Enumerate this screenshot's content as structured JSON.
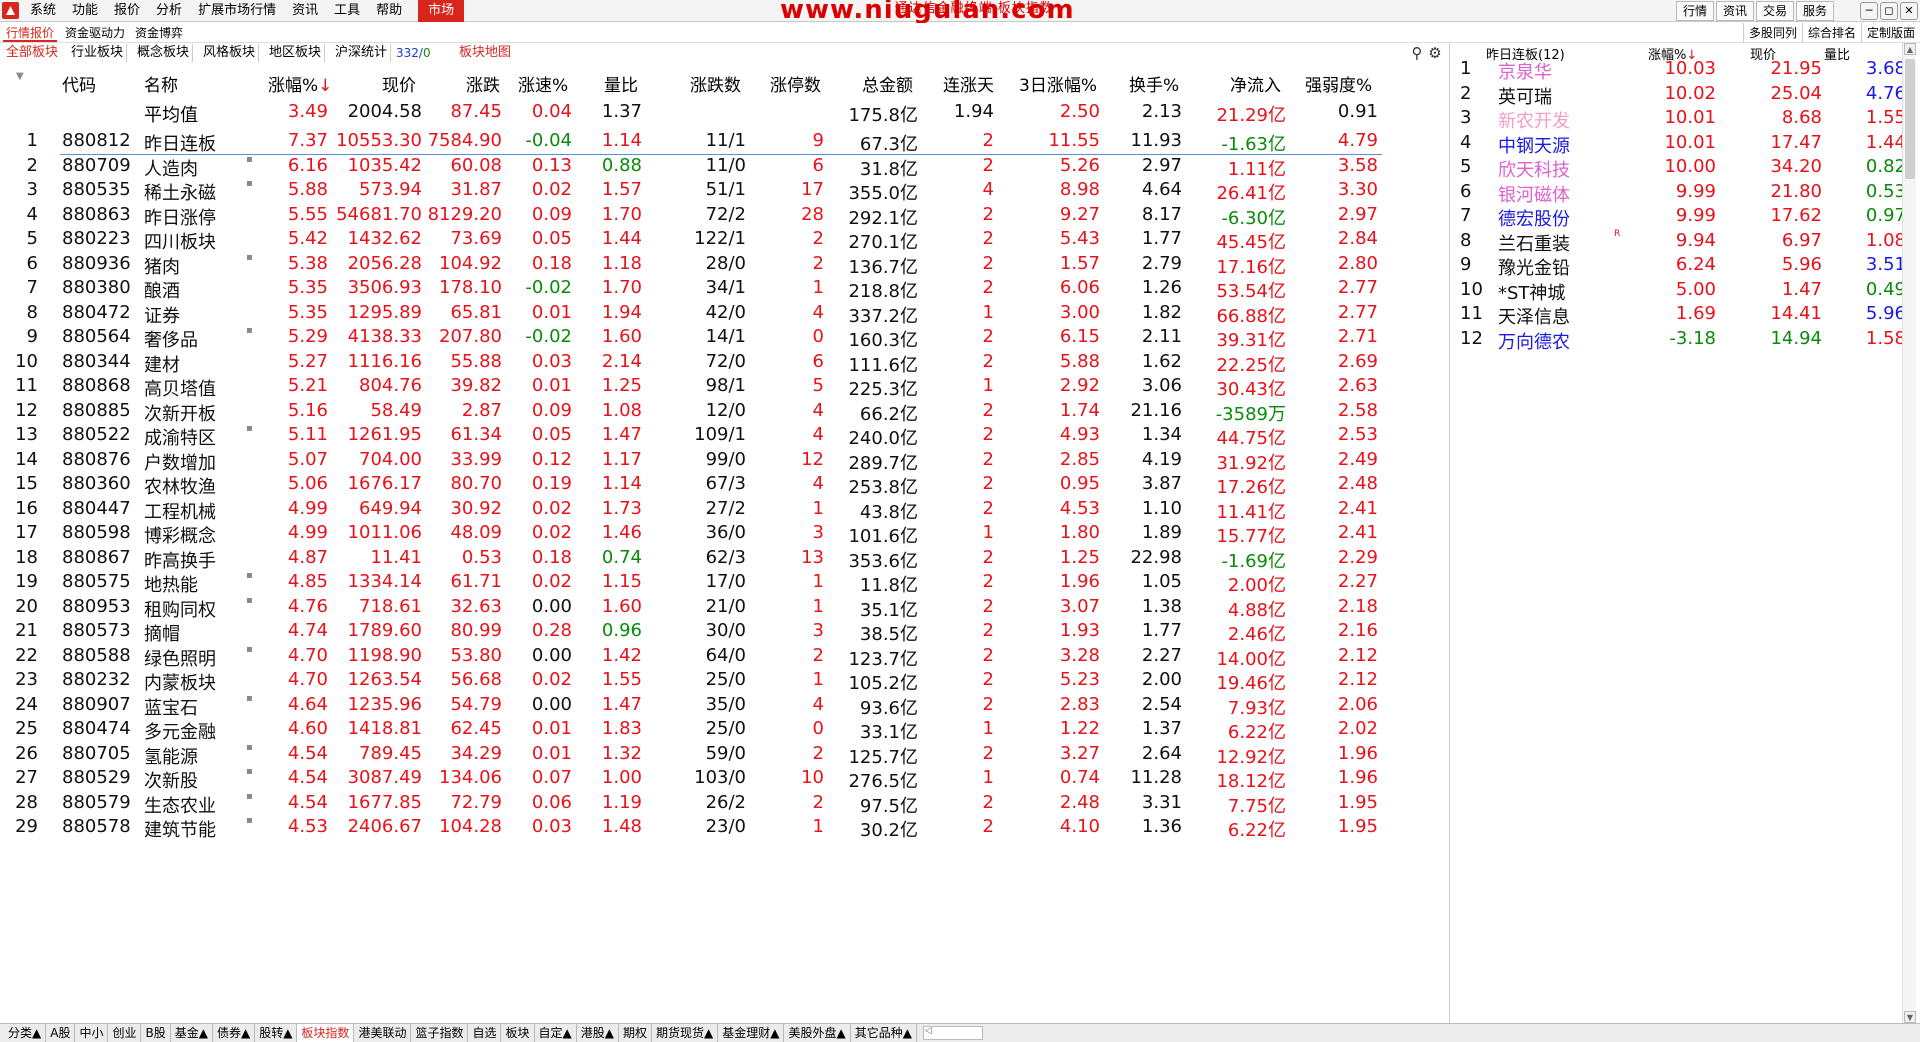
{
  "menu": [
    "系统",
    "功能",
    "报价",
    "分析",
    "扩展市场行情",
    "资讯",
    "工具",
    "帮助",
    "市场"
  ],
  "title": "www.niugulan.com",
  "subtitle": "通达信金融终端 板块指数",
  "right_buttons": [
    "行情",
    "资讯",
    "交易",
    "服务"
  ],
  "window_controls": [
    "─",
    "◻",
    "✕"
  ],
  "tabs1": [
    "行情报价",
    "资金驱动力",
    "资金博弈"
  ],
  "tabs1_right": [
    "多股同列",
    "综合排名",
    "定制版面"
  ],
  "tabs2": [
    "全部板块",
    "行业板块",
    "概念板块",
    "风格板块",
    "地区板块",
    "沪深统计"
  ],
  "counter": {
    "a": "332",
    "sep": "/",
    "b": "0"
  },
  "map_tab": "板块地图",
  "tool_icons": {
    "search": "⚲",
    "gear": "⚙"
  },
  "columns": {
    "code": "代码",
    "name": "名称",
    "chg": "涨幅%",
    "chg_arrow": "↓",
    "price": "现价",
    "diff": "涨跌",
    "speed": "涨速%",
    "vol": "量比",
    "ud": "涨跌数",
    "lim": "涨停数",
    "amt": "总金额",
    "streak": "连涨天",
    "d3": "3日涨幅%",
    "turn": "换手%",
    "flow": "净流入",
    "str": "强弱度%"
  },
  "avg_row": {
    "name": "平均值",
    "chg": "3.49",
    "price": "2004.58",
    "diff": "87.45",
    "speed": "0.04",
    "vol": "1.37",
    "amt": "175.8亿",
    "streak": "1.94",
    "d3": "2.50",
    "turn": "2.13",
    "flow": "21.29亿",
    "str": "0.91"
  },
  "rows": [
    {
      "idx": "1",
      "code": "880812",
      "name": "昨日连板",
      "dot": "",
      "chg": "7.37",
      "price": "10553.30",
      "diff": "7584.90",
      "speed": "-0.04",
      "vol": "1.14",
      "ud": "11/1",
      "lim": "9",
      "amt": "67.3亿",
      "streak": "2",
      "d3": "11.55",
      "turn": "11.93",
      "flow": "-1.63亿",
      "str": "4.79"
    },
    {
      "idx": "2",
      "code": "880709",
      "name": "人造肉",
      "dot": "▪",
      "chg": "6.16",
      "price": "1035.42",
      "diff": "60.08",
      "speed": "0.13",
      "vol": "0.88",
      "ud": "11/0",
      "lim": "6",
      "amt": "31.8亿",
      "streak": "2",
      "d3": "5.26",
      "turn": "2.97",
      "flow": "1.11亿",
      "str": "3.58"
    },
    {
      "idx": "3",
      "code": "880535",
      "name": "稀土永磁",
      "dot": "▪",
      "chg": "5.88",
      "price": "573.94",
      "diff": "31.87",
      "speed": "0.02",
      "vol": "1.57",
      "ud": "51/1",
      "lim": "17",
      "amt": "355.0亿",
      "streak": "4",
      "d3": "8.98",
      "turn": "4.64",
      "flow": "26.41亿",
      "str": "3.30"
    },
    {
      "idx": "4",
      "code": "880863",
      "name": "昨日涨停",
      "dot": "",
      "chg": "5.55",
      "price": "54681.70",
      "diff": "8129.20",
      "speed": "0.09",
      "vol": "1.70",
      "ud": "72/2",
      "lim": "28",
      "amt": "292.1亿",
      "streak": "2",
      "d3": "9.27",
      "turn": "8.17",
      "flow": "-6.30亿",
      "str": "2.97"
    },
    {
      "idx": "5",
      "code": "880223",
      "name": "四川板块",
      "dot": "",
      "chg": "5.42",
      "price": "1432.62",
      "diff": "73.69",
      "speed": "0.05",
      "vol": "1.44",
      "ud": "122/1",
      "lim": "2",
      "amt": "270.1亿",
      "streak": "2",
      "d3": "5.43",
      "turn": "1.77",
      "flow": "45.45亿",
      "str": "2.84"
    },
    {
      "idx": "6",
      "code": "880936",
      "name": "猪肉",
      "dot": "▪",
      "chg": "5.38",
      "price": "2056.28",
      "diff": "104.92",
      "speed": "0.18",
      "vol": "1.18",
      "ud": "28/0",
      "lim": "2",
      "amt": "136.7亿",
      "streak": "2",
      "d3": "1.57",
      "turn": "2.79",
      "flow": "17.16亿",
      "str": "2.80"
    },
    {
      "idx": "7",
      "code": "880380",
      "name": "酿酒",
      "dot": "",
      "chg": "5.35",
      "price": "3506.93",
      "diff": "178.10",
      "speed": "-0.02",
      "vol": "1.70",
      "ud": "34/1",
      "lim": "1",
      "amt": "218.8亿",
      "streak": "2",
      "d3": "6.06",
      "turn": "1.26",
      "flow": "53.54亿",
      "str": "2.77"
    },
    {
      "idx": "8",
      "code": "880472",
      "name": "证券",
      "dot": "",
      "chg": "5.35",
      "price": "1295.89",
      "diff": "65.81",
      "speed": "0.01",
      "vol": "1.94",
      "ud": "42/0",
      "lim": "4",
      "amt": "337.2亿",
      "streak": "1",
      "d3": "3.00",
      "turn": "1.82",
      "flow": "66.88亿",
      "str": "2.77"
    },
    {
      "idx": "9",
      "code": "880564",
      "name": "奢侈品",
      "dot": "▪",
      "chg": "5.29",
      "price": "4138.33",
      "diff": "207.80",
      "speed": "-0.02",
      "vol": "1.60",
      "ud": "14/1",
      "lim": "0",
      "amt": "160.3亿",
      "streak": "2",
      "d3": "6.15",
      "turn": "2.11",
      "flow": "39.31亿",
      "str": "2.71"
    },
    {
      "idx": "10",
      "code": "880344",
      "name": "建材",
      "dot": "",
      "chg": "5.27",
      "price": "1116.16",
      "diff": "55.88",
      "speed": "0.03",
      "vol": "2.14",
      "ud": "72/0",
      "lim": "6",
      "amt": "111.6亿",
      "streak": "2",
      "d3": "5.88",
      "turn": "1.62",
      "flow": "22.25亿",
      "str": "2.69"
    },
    {
      "idx": "11",
      "code": "880868",
      "name": "高贝塔值",
      "dot": "",
      "chg": "5.21",
      "price": "804.76",
      "diff": "39.82",
      "speed": "0.01",
      "vol": "1.25",
      "ud": "98/1",
      "lim": "5",
      "amt": "225.3亿",
      "streak": "1",
      "d3": "2.92",
      "turn": "3.06",
      "flow": "30.43亿",
      "str": "2.63"
    },
    {
      "idx": "12",
      "code": "880885",
      "name": "次新开板",
      "dot": "",
      "chg": "5.16",
      "price": "58.49",
      "diff": "2.87",
      "speed": "0.09",
      "vol": "1.08",
      "ud": "12/0",
      "lim": "4",
      "amt": "66.2亿",
      "streak": "2",
      "d3": "1.74",
      "turn": "21.16",
      "flow": "-3589万",
      "str": "2.58"
    },
    {
      "idx": "13",
      "code": "880522",
      "name": "成渝特区",
      "dot": "▪",
      "chg": "5.11",
      "price": "1261.95",
      "diff": "61.34",
      "speed": "0.05",
      "vol": "1.47",
      "ud": "109/1",
      "lim": "4",
      "amt": "240.0亿",
      "streak": "2",
      "d3": "4.93",
      "turn": "1.34",
      "flow": "44.75亿",
      "str": "2.53"
    },
    {
      "idx": "14",
      "code": "880876",
      "name": "户数增加",
      "dot": "",
      "chg": "5.07",
      "price": "704.00",
      "diff": "33.99",
      "speed": "0.12",
      "vol": "1.17",
      "ud": "99/0",
      "lim": "12",
      "amt": "289.7亿",
      "streak": "2",
      "d3": "2.85",
      "turn": "4.19",
      "flow": "31.92亿",
      "str": "2.49"
    },
    {
      "idx": "15",
      "code": "880360",
      "name": "农林牧渔",
      "dot": "",
      "chg": "5.06",
      "price": "1676.17",
      "diff": "80.70",
      "speed": "0.19",
      "vol": "1.14",
      "ud": "67/3",
      "lim": "4",
      "amt": "253.8亿",
      "streak": "2",
      "d3": "0.95",
      "turn": "3.87",
      "flow": "17.26亿",
      "str": "2.48"
    },
    {
      "idx": "16",
      "code": "880447",
      "name": "工程机械",
      "dot": "",
      "chg": "4.99",
      "price": "649.94",
      "diff": "30.92",
      "speed": "0.02",
      "vol": "1.73",
      "ud": "27/2",
      "lim": "1",
      "amt": "43.8亿",
      "streak": "2",
      "d3": "4.53",
      "turn": "1.10",
      "flow": "11.41亿",
      "str": "2.41"
    },
    {
      "idx": "17",
      "code": "880598",
      "name": "博彩概念",
      "dot": "",
      "chg": "4.99",
      "price": "1011.06",
      "diff": "48.09",
      "speed": "0.02",
      "vol": "1.46",
      "ud": "36/0",
      "lim": "3",
      "amt": "101.6亿",
      "streak": "1",
      "d3": "1.80",
      "turn": "1.89",
      "flow": "15.77亿",
      "str": "2.41"
    },
    {
      "idx": "18",
      "code": "880867",
      "name": "昨高换手",
      "dot": "",
      "chg": "4.87",
      "price": "11.41",
      "diff": "0.53",
      "speed": "0.18",
      "vol": "0.74",
      "ud": "62/3",
      "lim": "13",
      "amt": "353.6亿",
      "streak": "2",
      "d3": "1.25",
      "turn": "22.98",
      "flow": "-1.69亿",
      "str": "2.29"
    },
    {
      "idx": "19",
      "code": "880575",
      "name": "地热能",
      "dot": "▪",
      "chg": "4.85",
      "price": "1334.14",
      "diff": "61.71",
      "speed": "0.02",
      "vol": "1.15",
      "ud": "17/0",
      "lim": "1",
      "amt": "11.8亿",
      "streak": "2",
      "d3": "1.96",
      "turn": "1.05",
      "flow": "2.00亿",
      "str": "2.27"
    },
    {
      "idx": "20",
      "code": "880953",
      "name": "租购同权",
      "dot": "▪",
      "chg": "4.76",
      "price": "718.61",
      "diff": "32.63",
      "speed": "0.00",
      "vol": "1.60",
      "ud": "21/0",
      "lim": "1",
      "amt": "35.1亿",
      "streak": "2",
      "d3": "3.07",
      "turn": "1.38",
      "flow": "4.88亿",
      "str": "2.18"
    },
    {
      "idx": "21",
      "code": "880573",
      "name": "摘帽",
      "dot": "",
      "chg": "4.74",
      "price": "1789.60",
      "diff": "80.99",
      "speed": "0.28",
      "vol": "0.96",
      "ud": "30/0",
      "lim": "3",
      "amt": "38.5亿",
      "streak": "2",
      "d3": "1.93",
      "turn": "1.77",
      "flow": "2.46亿",
      "str": "2.16"
    },
    {
      "idx": "22",
      "code": "880588",
      "name": "绿色照明",
      "dot": "▪",
      "chg": "4.70",
      "price": "1198.90",
      "diff": "53.80",
      "speed": "0.00",
      "vol": "1.42",
      "ud": "64/0",
      "lim": "2",
      "amt": "123.7亿",
      "streak": "2",
      "d3": "3.28",
      "turn": "2.27",
      "flow": "14.00亿",
      "str": "2.12"
    },
    {
      "idx": "23",
      "code": "880232",
      "name": "内蒙板块",
      "dot": "",
      "chg": "4.70",
      "price": "1263.54",
      "diff": "56.68",
      "speed": "0.02",
      "vol": "1.55",
      "ud": "25/0",
      "lim": "1",
      "amt": "105.2亿",
      "streak": "2",
      "d3": "5.23",
      "turn": "2.00",
      "flow": "19.46亿",
      "str": "2.12"
    },
    {
      "idx": "24",
      "code": "880907",
      "name": "蓝宝石",
      "dot": "▪",
      "chg": "4.64",
      "price": "1235.96",
      "diff": "54.79",
      "speed": "0.00",
      "vol": "1.47",
      "ud": "35/0",
      "lim": "4",
      "amt": "93.6亿",
      "streak": "2",
      "d3": "2.83",
      "turn": "2.54",
      "flow": "7.93亿",
      "str": "2.06"
    },
    {
      "idx": "25",
      "code": "880474",
      "name": "多元金融",
      "dot": "",
      "chg": "4.60",
      "price": "1418.81",
      "diff": "62.45",
      "speed": "0.01",
      "vol": "1.83",
      "ud": "25/0",
      "lim": "0",
      "amt": "33.1亿",
      "streak": "1",
      "d3": "1.22",
      "turn": "1.37",
      "flow": "6.22亿",
      "str": "2.02"
    },
    {
      "idx": "26",
      "code": "880705",
      "name": "氢能源",
      "dot": "▪",
      "chg": "4.54",
      "price": "789.45",
      "diff": "34.29",
      "speed": "0.01",
      "vol": "1.32",
      "ud": "59/0",
      "lim": "2",
      "amt": "125.7亿",
      "streak": "2",
      "d3": "3.27",
      "turn": "2.64",
      "flow": "12.92亿",
      "str": "1.96"
    },
    {
      "idx": "27",
      "code": "880529",
      "name": "次新股",
      "dot": "▪",
      "chg": "4.54",
      "price": "3087.49",
      "diff": "134.06",
      "speed": "0.07",
      "vol": "1.00",
      "ud": "103/0",
      "lim": "10",
      "amt": "276.5亿",
      "streak": "1",
      "d3": "0.74",
      "turn": "11.28",
      "flow": "18.12亿",
      "str": "1.96"
    },
    {
      "idx": "28",
      "code": "880579",
      "name": "生态农业",
      "dot": "▪",
      "chg": "4.54",
      "price": "1677.85",
      "diff": "72.79",
      "speed": "0.06",
      "vol": "1.19",
      "ud": "26/2",
      "lim": "2",
      "amt": "97.5亿",
      "streak": "2",
      "d3": "2.48",
      "turn": "3.31",
      "flow": "7.75亿",
      "str": "1.95"
    },
    {
      "idx": "29",
      "code": "880578",
      "name": "建筑节能",
      "dot": "▪",
      "chg": "4.53",
      "price": "2406.67",
      "diff": "104.28",
      "speed": "0.03",
      "vol": "1.48",
      "ud": "23/0",
      "lim": "1",
      "amt": "30.2亿",
      "streak": "2",
      "d3": "4.10",
      "turn": "1.36",
      "flow": "6.22亿",
      "str": "1.95"
    }
  ],
  "right_panel": {
    "title": "昨日连板",
    "count": "(12)",
    "col_chg": "涨幅%",
    "chg_arrow": "↓",
    "col_price": "现价",
    "col_vol": "量比",
    "rows": [
      {
        "idx": "1",
        "name": "京泉华",
        "cls": "mag",
        "mark": "",
        "chg": "10.03",
        "price": "21.95",
        "vol": "3.68",
        "vcls": "blu"
      },
      {
        "idx": "2",
        "name": "英可瑞",
        "cls": "blk",
        "mark": "",
        "chg": "10.02",
        "price": "25.04",
        "vol": "4.76",
        "vcls": "blu"
      },
      {
        "idx": "3",
        "name": "新农开发",
        "cls": "pink",
        "mark": "",
        "chg": "10.01",
        "price": "8.68",
        "vol": "1.55",
        "vcls": "red"
      },
      {
        "idx": "4",
        "name": "中钢天源",
        "cls": "dblu",
        "mark": "",
        "chg": "10.01",
        "price": "17.47",
        "vol": "1.44",
        "vcls": "red"
      },
      {
        "idx": "5",
        "name": "欣天科技",
        "cls": "mag",
        "mark": "",
        "chg": "10.00",
        "price": "34.20",
        "vol": "0.82",
        "vcls": "grn"
      },
      {
        "idx": "6",
        "name": "银河磁体",
        "cls": "mag",
        "mark": "",
        "chg": "9.99",
        "price": "21.80",
        "vol": "0.53",
        "vcls": "grn"
      },
      {
        "idx": "7",
        "name": "德宏股份",
        "cls": "dblu",
        "mark": "",
        "chg": "9.99",
        "price": "17.62",
        "vol": "0.97",
        "vcls": "grn"
      },
      {
        "idx": "8",
        "name": "兰石重装",
        "cls": "blk",
        "mark": "R",
        "chg": "9.94",
        "price": "6.97",
        "vol": "1.08",
        "vcls": "red"
      },
      {
        "idx": "9",
        "name": "豫光金铅",
        "cls": "blk",
        "mark": "",
        "chg": "6.24",
        "price": "5.96",
        "vol": "3.51",
        "vcls": "blu"
      },
      {
        "idx": "10",
        "name": "*ST神城",
        "cls": "blk",
        "mark": "",
        "chg": "5.00",
        "price": "1.47",
        "vol": "0.49",
        "vcls": "grn"
      },
      {
        "idx": "11",
        "name": "天泽信息",
        "cls": "blk",
        "mark": "",
        "chg": "1.69",
        "price": "14.41",
        "vol": "5.96",
        "vcls": "blu"
      },
      {
        "idx": "12",
        "name": "万向德农",
        "cls": "dblu",
        "mark": "",
        "chg": "-3.18",
        "price": "14.94",
        "vol": "1.58",
        "vcls": "red"
      }
    ]
  },
  "bottom_tabs": [
    "分类▲",
    "A股",
    "中小",
    "创业",
    "B股",
    "基金▲",
    "债券▲",
    "股转▲",
    "板块指数",
    "港美联动",
    "篮子指数",
    "自选",
    "板块",
    "自定▲",
    "港股▲",
    "期权",
    "期货现货▲",
    "基金理财▲",
    "美股外盘▲",
    "其它品种▲"
  ],
  "colors": {
    "up": "#e8121a",
    "down": "#0a8a0a",
    "accent": "#d9261c",
    "sep": "#5b8fd6"
  }
}
